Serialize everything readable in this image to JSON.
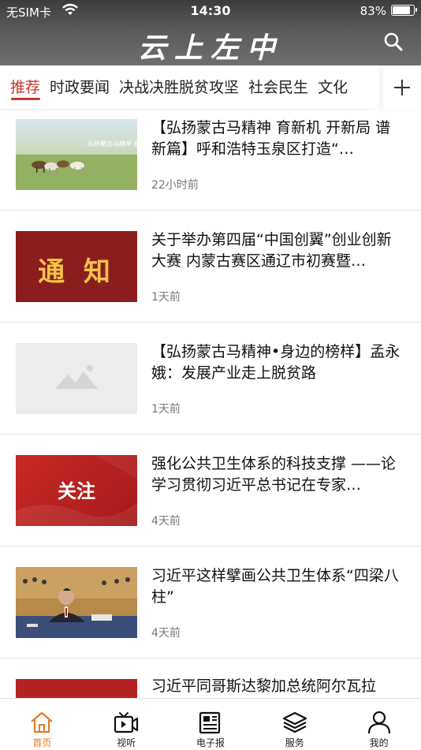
{
  "status_bar": {
    "carrier": "无SIM卡",
    "time": "14:30",
    "battery": "83%"
  },
  "header": {
    "title": "云上左中",
    "search_icon": "search-icon"
  },
  "tabs": [
    {
      "label": "推荐",
      "active": true
    },
    {
      "label": "时政要闻"
    },
    {
      "label": "决战决胜脱贫攻坚"
    },
    {
      "label": "社会民生"
    },
    {
      "label": "文化"
    }
  ],
  "news": [
    {
      "title": "【弘扬蒙古马精神 育新机 开新局 谱新篇】呼和浩特玉泉区打造“…",
      "time": "22小时前",
      "thumb_text": "弘扬蒙古马精神 身边的榜样"
    },
    {
      "title": "关于举办第四届“中国创翼”创业创新大赛 内蒙古赛区通辽市初赛暨…",
      "time": "1天前",
      "thumb_text": "通 知"
    },
    {
      "title": "【弘扬蒙古马精神•身边的榜样】孟永娥：发展产业走上脱贫路",
      "time": "1天前",
      "thumb_text": ""
    },
    {
      "title": "强化公共卫生体系的科技支撑 ——论学习贯彻习近平总书记在专家…",
      "time": "4天前",
      "thumb_text": "关注"
    },
    {
      "title": "习近平这样擘画公共卫生体系“四梁八柱”",
      "time": "4天前",
      "thumb_text": ""
    },
    {
      "title": "习近平同哥斯达黎加总统阿尔瓦拉",
      "time": "",
      "thumb_text": ""
    }
  ],
  "tabbar": [
    {
      "label": "首页",
      "icon": "home-icon",
      "active": true
    },
    {
      "label": "视听",
      "icon": "video-icon"
    },
    {
      "label": "电子报",
      "icon": "newspaper-icon"
    },
    {
      "label": "服务",
      "icon": "layers-icon"
    },
    {
      "label": "我的",
      "icon": "person-icon"
    }
  ],
  "colors": {
    "accent": "#c9352b",
    "tabbar_active": "#e07a2a"
  }
}
